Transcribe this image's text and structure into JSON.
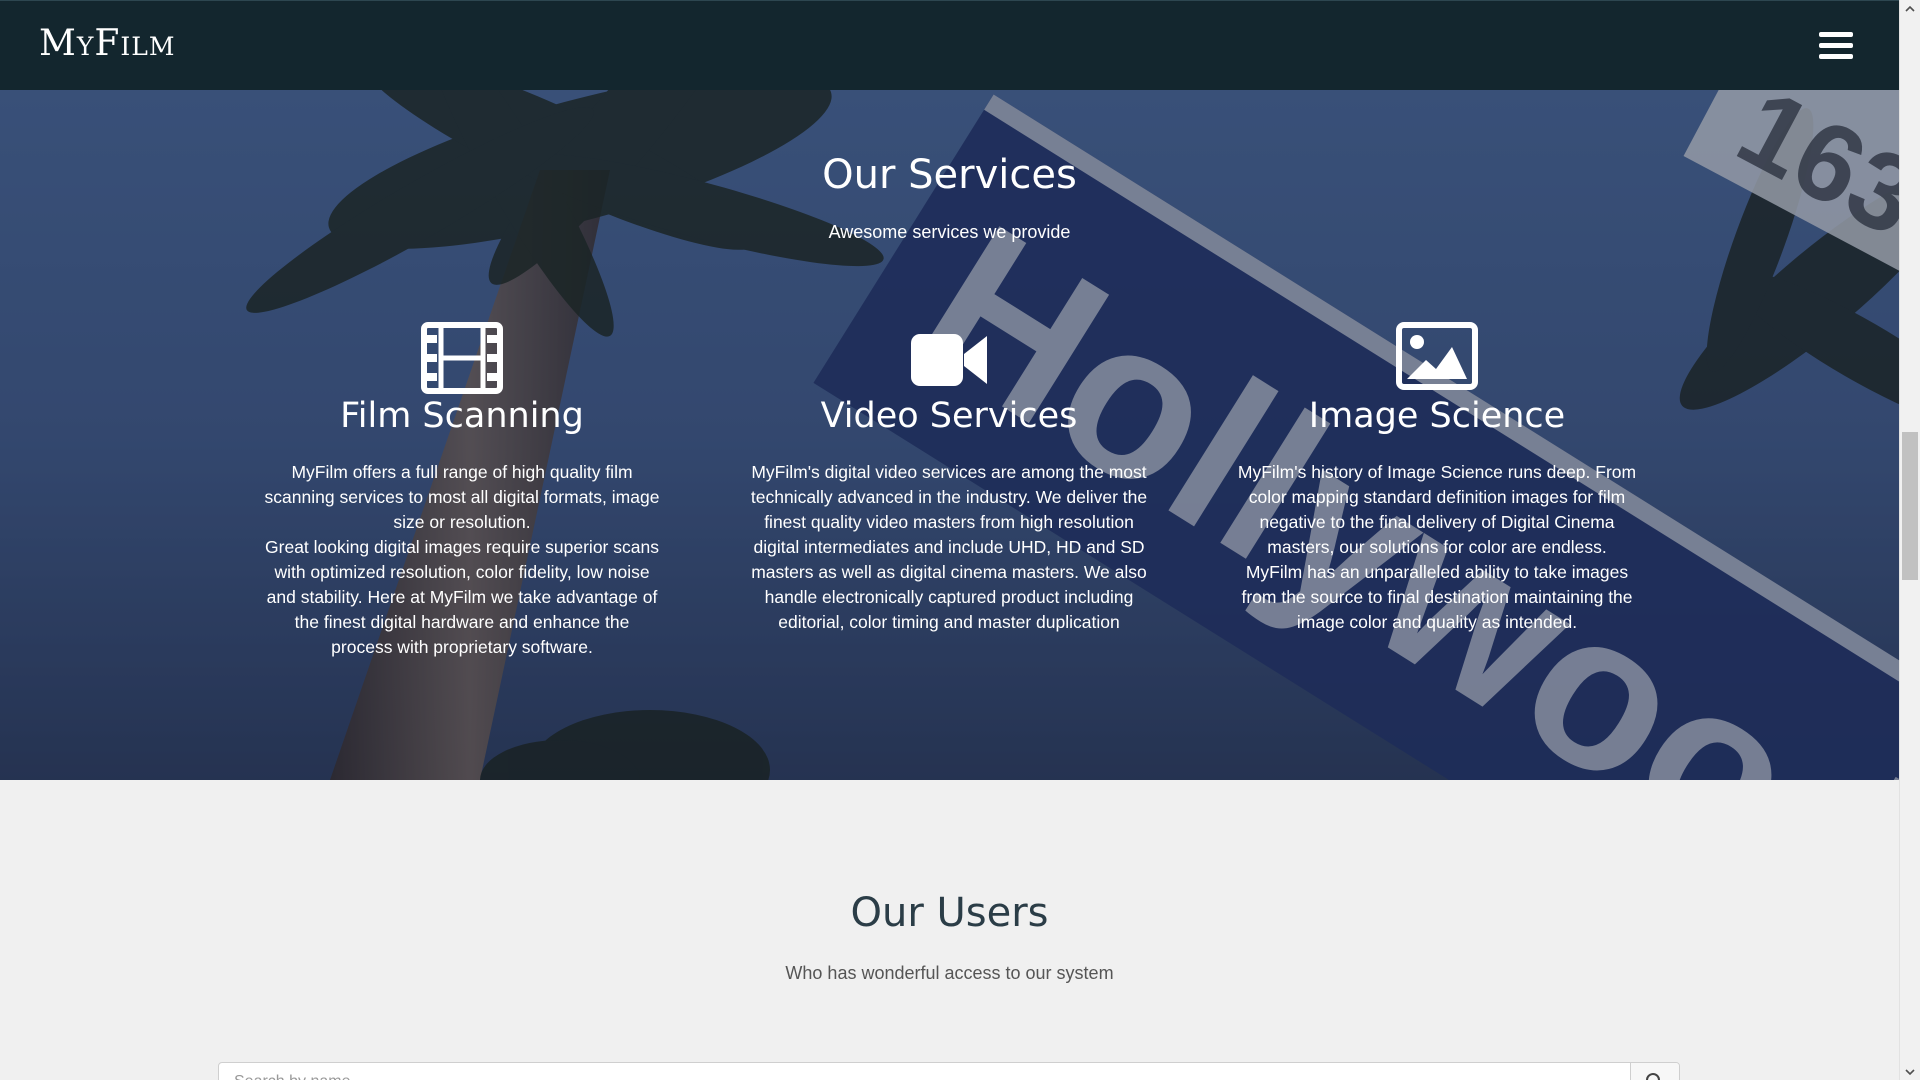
{
  "navbar": {
    "brand": "MyFilm",
    "menu_icon": "hamburger-menu-icon"
  },
  "services": {
    "title": "Our Services",
    "subtitle": "Awesome services we provide",
    "items": [
      {
        "icon": "film-icon",
        "title": "Film Scanning",
        "paragraphs": [
          "MyFilm offers a full range of high quality film scanning services to most all digital formats, image size or resolution.",
          "Great looking digital images require superior scans with optimized resolution, color fidelity, low noise and stability. Here at MyFilm we take advantage of the finest digital hardware and enhance the process with proprietary software."
        ]
      },
      {
        "icon": "video-camera-icon",
        "title": "Video Services",
        "paragraphs": [
          "MyFilm's digital video services are among the most technically advanced in the industry. We deliver the finest quality video masters from high resolution digital intermediates and include UHD, HD and SD masters as well as digital cinema masters. We also handle electronically captured product including editorial, color timing and master duplication"
        ]
      },
      {
        "icon": "image-icon",
        "title": "Image Science",
        "paragraphs": [
          "MyFilm's history of Image Science runs deep. From color mapping standard definition images for film negative to the final delivery of Digital Cinema masters, our solutions for color are endless. MyFilm has an unparalleled ability to take images from the source to final destination maintaining the image color and quality as intended."
        ]
      }
    ]
  },
  "users": {
    "title": "Our Users",
    "subtitle": "Who has wonderful access to our system",
    "search": {
      "placeholder": "Search by name...",
      "value": "",
      "button_icon": "search-icon"
    }
  },
  "colors": {
    "navbar_bg": "#13262e",
    "page_bg": "#f0f0f0",
    "heading_dark": "#2b3d47"
  }
}
